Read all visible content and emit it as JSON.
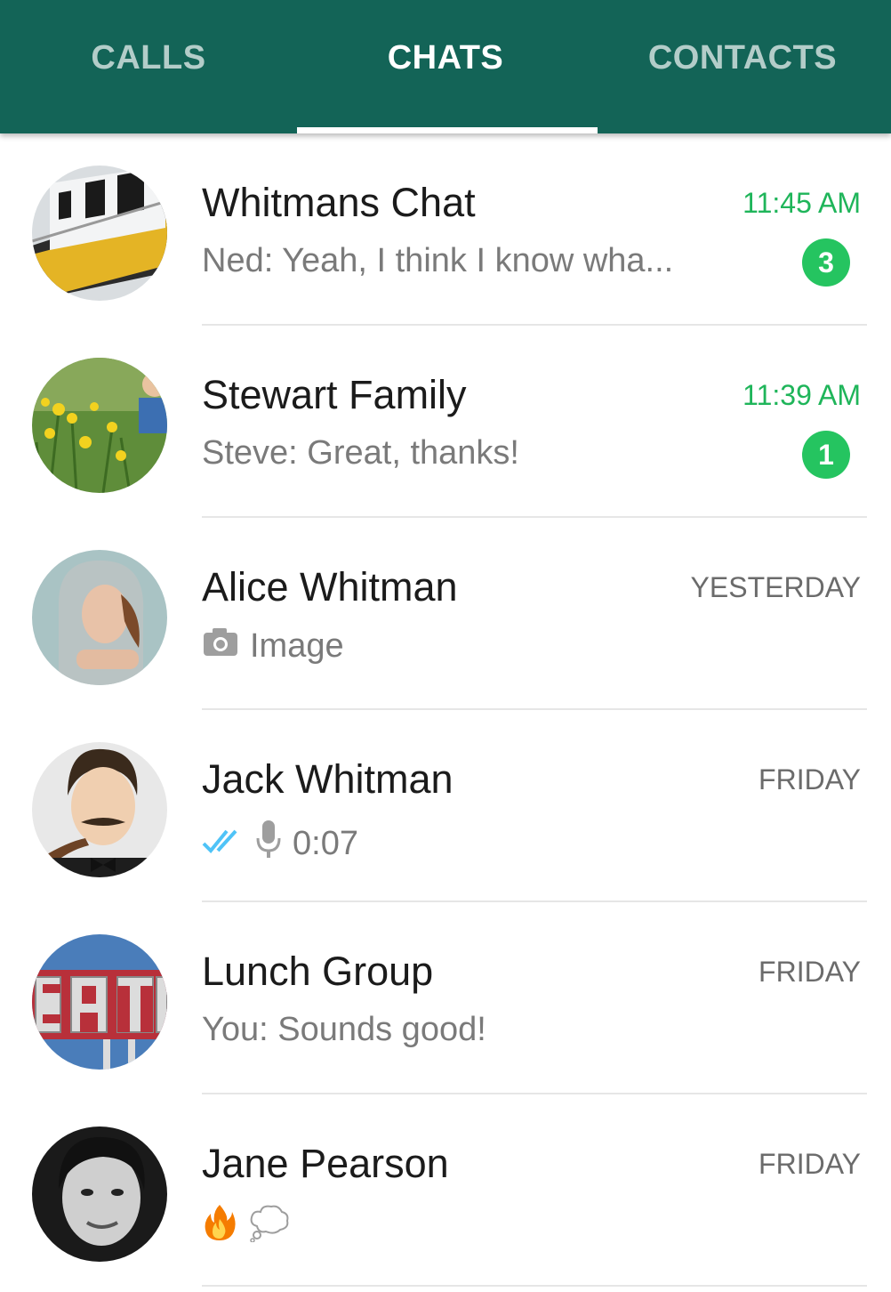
{
  "tabs": [
    {
      "label": "CALLS",
      "active": false
    },
    {
      "label": "CHATS",
      "active": true
    },
    {
      "label": "CONTACTS",
      "active": false
    }
  ],
  "colors": {
    "app_bar": "#136457",
    "unread_accent": "#1fb55a",
    "badge": "#25c460",
    "read_receipt": "#4fc3f7"
  },
  "chats": [
    {
      "name": "Whitmans Chat",
      "time": "11:45 AM",
      "preview": "Ned: Yeah, I think I know wha...",
      "unread_count": "3",
      "avatar": "boat-photo"
    },
    {
      "name": "Stewart Family",
      "time": "11:39 AM",
      "preview": "Steve: Great, thanks!",
      "unread_count": "1",
      "avatar": "flowers-photo"
    },
    {
      "name": "Alice Whitman",
      "time": "YESTERDAY",
      "preview": "Image",
      "preview_icon": "camera-icon",
      "avatar": "woman-hood-photo"
    },
    {
      "name": "Jack Whitman",
      "time": "FRIDAY",
      "preview": "0:07",
      "preview_icons": [
        "double-check-icon",
        "microphone-icon"
      ],
      "avatar": "man-pipe-photo"
    },
    {
      "name": "Lunch Group",
      "time": "FRIDAY",
      "preview": "You: Sounds good!",
      "avatar": "eat-sign-photo"
    },
    {
      "name": "Jane Pearson",
      "time": "FRIDAY",
      "preview_icons": [
        "fire-emoji-icon",
        "thought-bubble-icon"
      ],
      "avatar": "woman-bw-photo"
    }
  ]
}
